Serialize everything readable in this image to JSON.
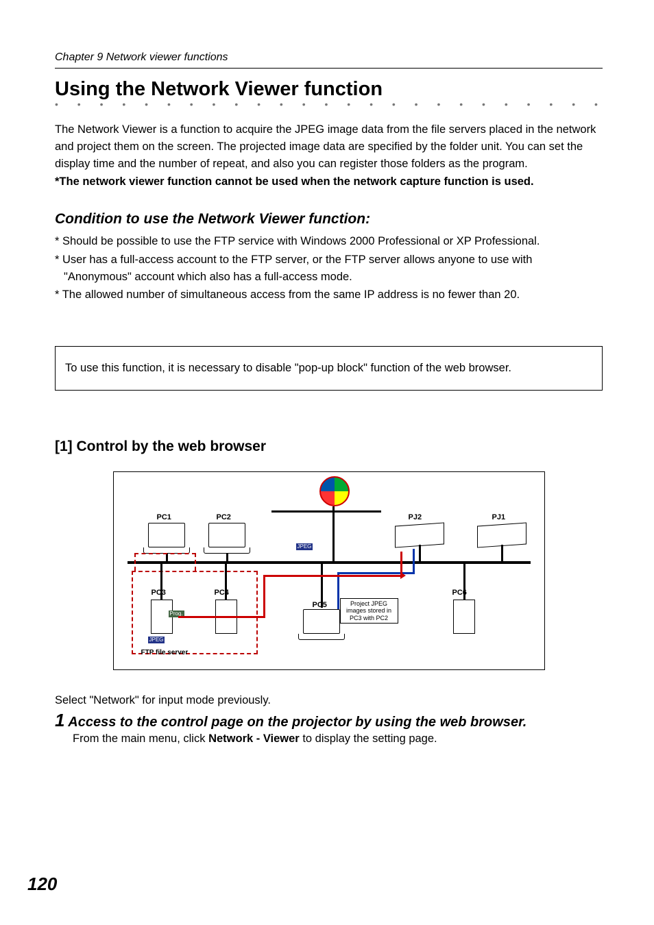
{
  "chapter": "Chapter 9 Network viewer functions",
  "h1": "Using the Network Viewer function",
  "intro": "The Network Viewer is a function to acquire the JPEG image data from the file servers placed in the network and project them on the screen. The projected image data are specified by the folder unit. You can set the display time and the number of repeat, and also you can register those folders as the program.",
  "intro_bold": "*The network viewer function cannot be used when the network capture function is used.",
  "cond_heading": "Condition to use the Network Viewer function:",
  "cond": {
    "c1": "* Should be possible to use the FTP service with Windows 2000 Professional or XP Professional.",
    "c2": "* User has a full-access account to the FTP server, or the FTP server allows anyone to use with \"Anonymous\" account which also has a full-access mode.",
    "c3": "* The allowed number of simultaneous access from the same IP address is no fewer than 20."
  },
  "notice": "To use this function, it is necessary to disable \"pop-up block\" function of the web browser.",
  "section1_heading": "[1] Control by the web browser",
  "diagram": {
    "pc1": "PC1",
    "pc2": "PC2",
    "pc3": "PC3",
    "pc4": "PC4",
    "pc5": "PC5",
    "pc6": "PC6",
    "pj1": "PJ1",
    "pj2": "PJ2",
    "ftp": "FTP file server",
    "jpeg": "JPEG",
    "prog": "Prog.",
    "speech_line1": "Project JPEG",
    "speech_line2": "images stored in",
    "speech_line3": "PC3 with PC2"
  },
  "pretext": "Select \"Network\" for input mode previously.",
  "step1_head": "Access to the control page on the projector by using the web browser.",
  "step1_num": "1",
  "step1_body_a": "From the main menu, click ",
  "step1_body_b": "Network - Viewer",
  "step1_body_c": " to display the setting page.",
  "pagenum": "120"
}
